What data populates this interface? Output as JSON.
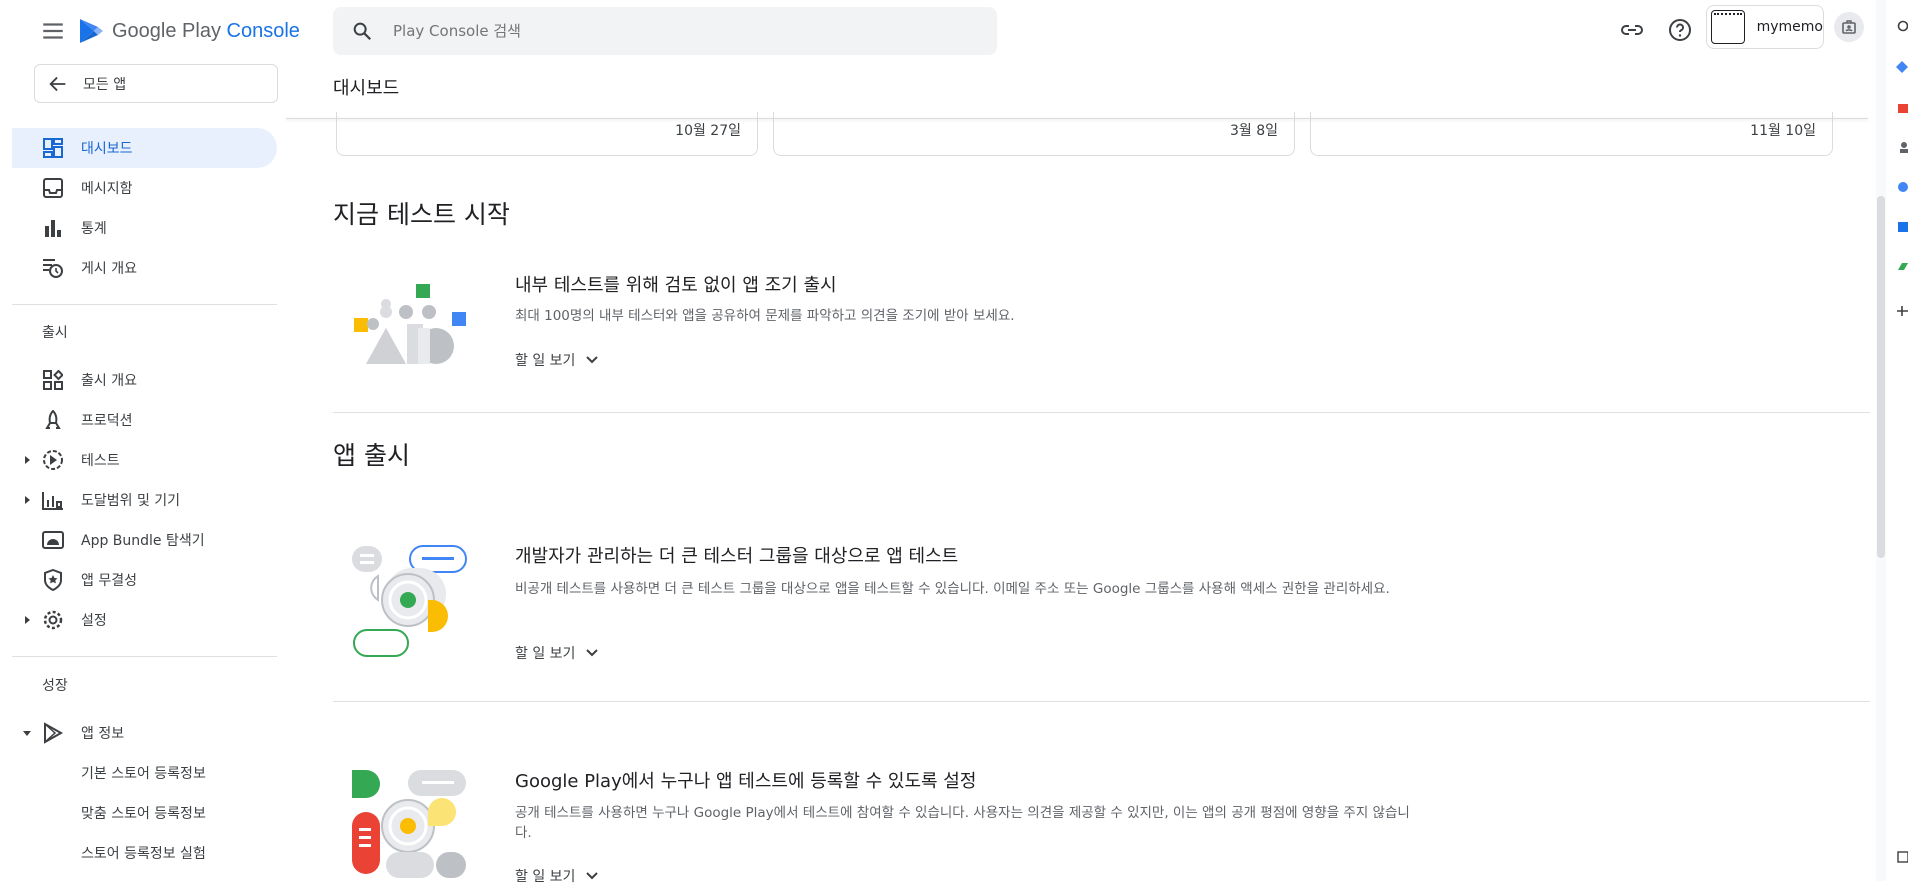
{
  "header": {
    "logo_text_main": "Google Play",
    "logo_text_accent": "Console",
    "search_placeholder": "Play Console 검색",
    "account_name": "mymemo",
    "page_title": "대시보드"
  },
  "sidebar": {
    "all_apps_label": "모든 앱",
    "items_top": [
      {
        "label": "대시보드",
        "icon": "dashboard-icon",
        "active": true
      },
      {
        "label": "메시지함",
        "icon": "inbox-icon"
      },
      {
        "label": "통계",
        "icon": "bar-chart-icon"
      },
      {
        "label": "게시 개요",
        "icon": "publishing-overview-icon"
      }
    ],
    "release_section_title": "출시",
    "release_items": [
      {
        "label": "출시 개요",
        "icon": "release-overview-icon"
      },
      {
        "label": "프로덕션",
        "icon": "production-icon"
      },
      {
        "label": "테스트",
        "icon": "testing-icon",
        "expandable": true
      },
      {
        "label": "도달범위 및 기기",
        "icon": "reach-devices-icon",
        "expandable": true
      },
      {
        "label": "App Bundle 탐색기",
        "icon": "android-icon"
      },
      {
        "label": "앱 무결성",
        "icon": "shield-icon"
      },
      {
        "label": "설정",
        "icon": "gear-icon",
        "expandable": true
      }
    ],
    "growth_section_title": "성장",
    "growth_items": [
      {
        "label": "앱 정보",
        "icon": "play-icon",
        "expanded": true
      },
      {
        "label": "기본 스토어 등록정보"
      },
      {
        "label": "맞춤 스토어 등록정보"
      },
      {
        "label": "스토어 등록정보 실험"
      }
    ]
  },
  "date_cards": [
    "10월 27일",
    "3월 8일",
    "11월 10일"
  ],
  "main": {
    "start_testing_title": "지금 테스트 시작",
    "internal_test": {
      "title": "내부 테스트를 위해 검토 없이 앱 조기 출시",
      "desc": "최대 100명의 내부 테스터와 앱을 공유하여 문제를 파악하고 의견을 조기에 받아 보세요.",
      "todo": "할 일 보기"
    },
    "release_title": "앱 출시",
    "closed_test": {
      "title": "개발자가 관리하는 더 큰 테스터 그룹을 대상으로 앱 테스트",
      "desc": "비공개 테스트를 사용하면 더 큰 테스트 그룹을 대상으로 앱을 테스트할 수 있습니다. 이메일 주소 또는 Google 그룹스를 사용해 액세스 권한을 관리하세요.",
      "todo": "할 일 보기"
    },
    "open_test": {
      "title": "Google Play에서 누구나 앱 테스트에 등록할 수 있도록 설정",
      "desc": "공개 테스트를 사용하면 누구나 Google Play에서 테스트에 참여할 수 있습니다. 사용자는 의견을 제공할 수 있지만, 이는 앱의 공개 평점에 영향을 주지 않습니다.",
      "todo": "할 일 보기"
    }
  },
  "colors": {
    "accent": "#1a73e8",
    "active_bg": "#e8f0fe",
    "green": "#34a853",
    "yellow": "#fbbc04",
    "red": "#ea4335",
    "blue": "#4285f4"
  }
}
